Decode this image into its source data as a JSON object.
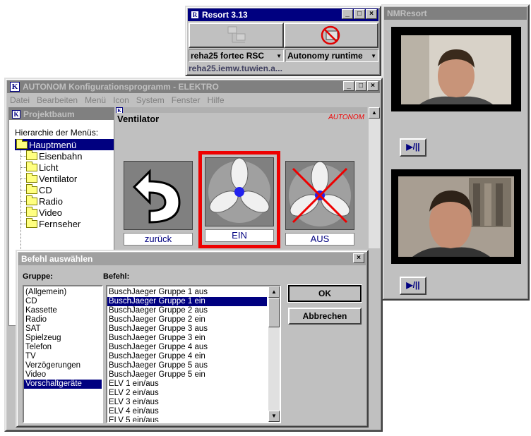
{
  "resort": {
    "title": "Resort 3.13",
    "device_select": "reha25 fortec RSC",
    "mode_select": "Autonomy runtime",
    "status": "reha25.iemw.tuwien.a..."
  },
  "nmresort": {
    "title": "NMResort",
    "play_label_1": "▶/||",
    "play_label_2": "▶/||"
  },
  "autonom": {
    "title": "AUTONOM Konfigurationsprogramm - ELEKTRO",
    "menu": [
      "Datei",
      "Bearbeiten",
      "Menü",
      "Icon",
      "System",
      "Fenster",
      "Hilfe"
    ]
  },
  "projektbaum": {
    "title": "Projektbaum",
    "heading": "Hierarchie der Menüs:",
    "items": [
      "Hauptmenü",
      "Eisenbahn",
      "Licht",
      "Ventilator",
      "CD",
      "Radio",
      "Video",
      "Fernseher"
    ]
  },
  "ventilator": {
    "title_partial": "Ventilator",
    "heading": "Ventilator",
    "brand": "AUTONOM",
    "tiles": [
      "zurück",
      "EIN",
      "AUS"
    ]
  },
  "dialog": {
    "title": "Befehl auswählen",
    "group_label": "Gruppe:",
    "command_label": "Befehl:",
    "groups": [
      "(Allgemein)",
      "CD",
      "Kassette",
      "Radio",
      "SAT",
      "Spielzeug",
      "Telefon",
      "TV",
      "Verzögerungen",
      "Video",
      "Vorschaltgeräte"
    ],
    "selected_group": "Vorschaltgeräte",
    "commands": [
      "BuschJaeger Gruppe 1 aus",
      "BuschJaeger Gruppe 1 ein",
      "BuschJaeger Gruppe 2 aus",
      "BuschJaeger Gruppe 2 ein",
      "BuschJaeger Gruppe 3 aus",
      "BuschJaeger Gruppe 3 ein",
      "BuschJaeger Gruppe 4 aus",
      "BuschJaeger Gruppe 4 ein",
      "BuschJaeger Gruppe 5 aus",
      "BuschJaeger Gruppe 5 ein",
      "ELV 1 ein/aus",
      "ELV 2 ein/aus",
      "ELV 3 ein/aus",
      "ELV 4 ein/aus",
      "ELV 5 ein/aus"
    ],
    "selected_command": "BuschJaeger Gruppe 1 ein",
    "ok_label": "OK",
    "cancel_label": "Abbrechen"
  },
  "colors": {
    "title_active": "#000080",
    "highlight_frame": "#ee0000",
    "brand_red": "#ee0000"
  }
}
